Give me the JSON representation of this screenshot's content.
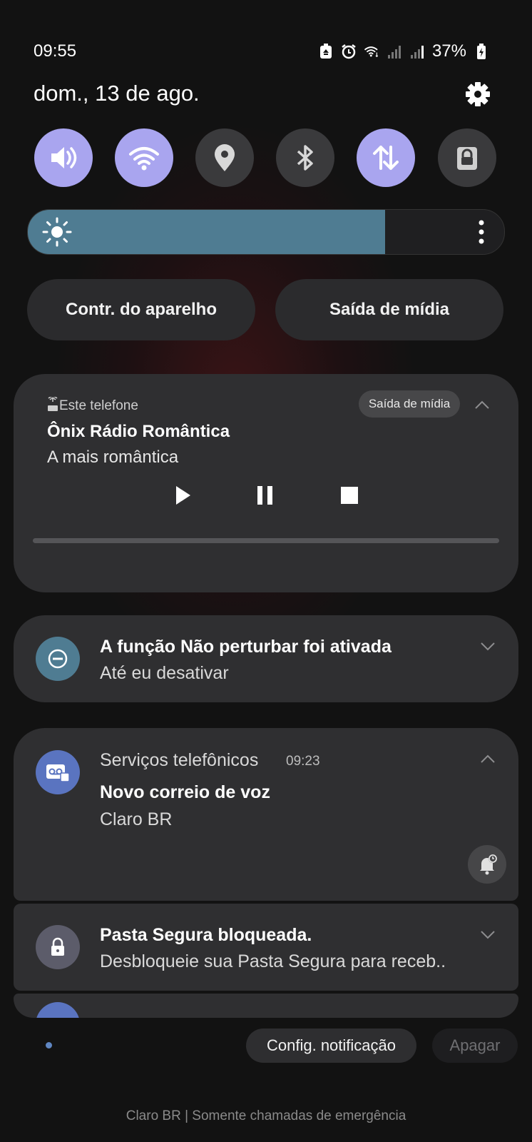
{
  "status_bar": {
    "time": "09:55",
    "battery": "37%",
    "icons": [
      "recycle-icon",
      "alarm-icon",
      "wifi-icon",
      "signal-icon",
      "signal-icon",
      "battery-charging-icon"
    ]
  },
  "header": {
    "date": "dom., 13 de ago."
  },
  "quick_toggles": [
    {
      "name": "sound",
      "icon": "volume-icon",
      "active": true
    },
    {
      "name": "wifi",
      "icon": "wifi-icon",
      "active": true
    },
    {
      "name": "location",
      "icon": "location-pin-icon",
      "active": false
    },
    {
      "name": "bluetooth",
      "icon": "bluetooth-icon",
      "active": false
    },
    {
      "name": "mobile-data",
      "icon": "data-arrows-icon",
      "active": true
    },
    {
      "name": "secure-folder",
      "icon": "lock-icon",
      "active": false
    }
  ],
  "brightness": {
    "level": 0.75
  },
  "buttons": {
    "device_control": "Contr. do aparelho",
    "media_output": "Saída de mídia"
  },
  "media_card": {
    "source": "Este telefone",
    "output_button": "Saída de mídia",
    "title": "Ônix Rádio Romântica",
    "subtitle": "A mais romântica",
    "progress": 0
  },
  "notifications": [
    {
      "title": "A função Não perturbar foi ativada",
      "subtitle": "Até eu desativar",
      "icon": "do-not-disturb-icon",
      "icon_color": "#4f7c92"
    },
    {
      "app": "Serviços telefônicos",
      "time": "09:23",
      "title": "Novo correio de voz",
      "subtitle": "Claro BR",
      "icon": "voicemail-icon",
      "icon_color": "#5a74c0"
    },
    {
      "title": "Pasta Segura bloqueada.",
      "subtitle": "Desbloqueie sua Pasta Segura para receb..",
      "icon": "lock-icon",
      "icon_color": "#5c5c6a"
    }
  ],
  "footer": {
    "notif_settings": "Config. notificação",
    "clear": "Apagar",
    "carrier": "Claro BR | Somente chamadas de emergência"
  },
  "colors": {
    "toggle_active": "#a9a5ef",
    "toggle_inactive": "#3a3a3c",
    "brightness_fill": "#4f7c92",
    "card_bg": "#2f2f31"
  }
}
